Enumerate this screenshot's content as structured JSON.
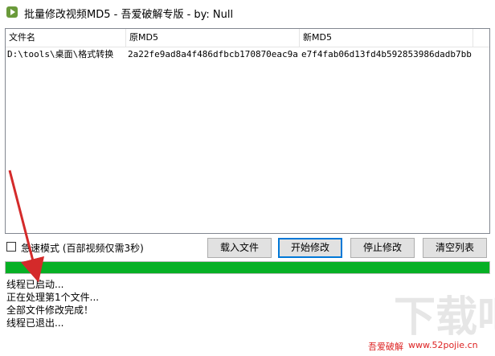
{
  "window": {
    "title": "批量修改视频MD5 - 吾爱破解专版 - by: Null",
    "icon": "video-app-icon"
  },
  "table": {
    "columns": [
      "文件名",
      "原MD5",
      "新MD5"
    ],
    "rows": [
      [
        "D:\\tools\\桌面\\格式转换",
        "2a22fe9ad8a4f486dfbcb170870eac9a",
        "e7f4fab06d13fd4b592853986dadb7bb"
      ]
    ]
  },
  "options": {
    "fast_mode_label": "急速模式 (百部视频仅需3秒)",
    "fast_mode_checked": false
  },
  "buttons": {
    "load": "载入文件",
    "start": "开始修改",
    "stop": "停止修改",
    "clear": "清空列表"
  },
  "progress": {
    "fraction": 1.0,
    "color": "#06b025"
  },
  "log": [
    "线程已启动...",
    "正在处理第1个文件...",
    "全部文件修改完成！",
    "线程已退出..."
  ],
  "watermark": {
    "left": "吾爱破解",
    "right": "www.52pojie.cn",
    "big": "下载吧"
  },
  "annotation_color": "#d42a2a"
}
